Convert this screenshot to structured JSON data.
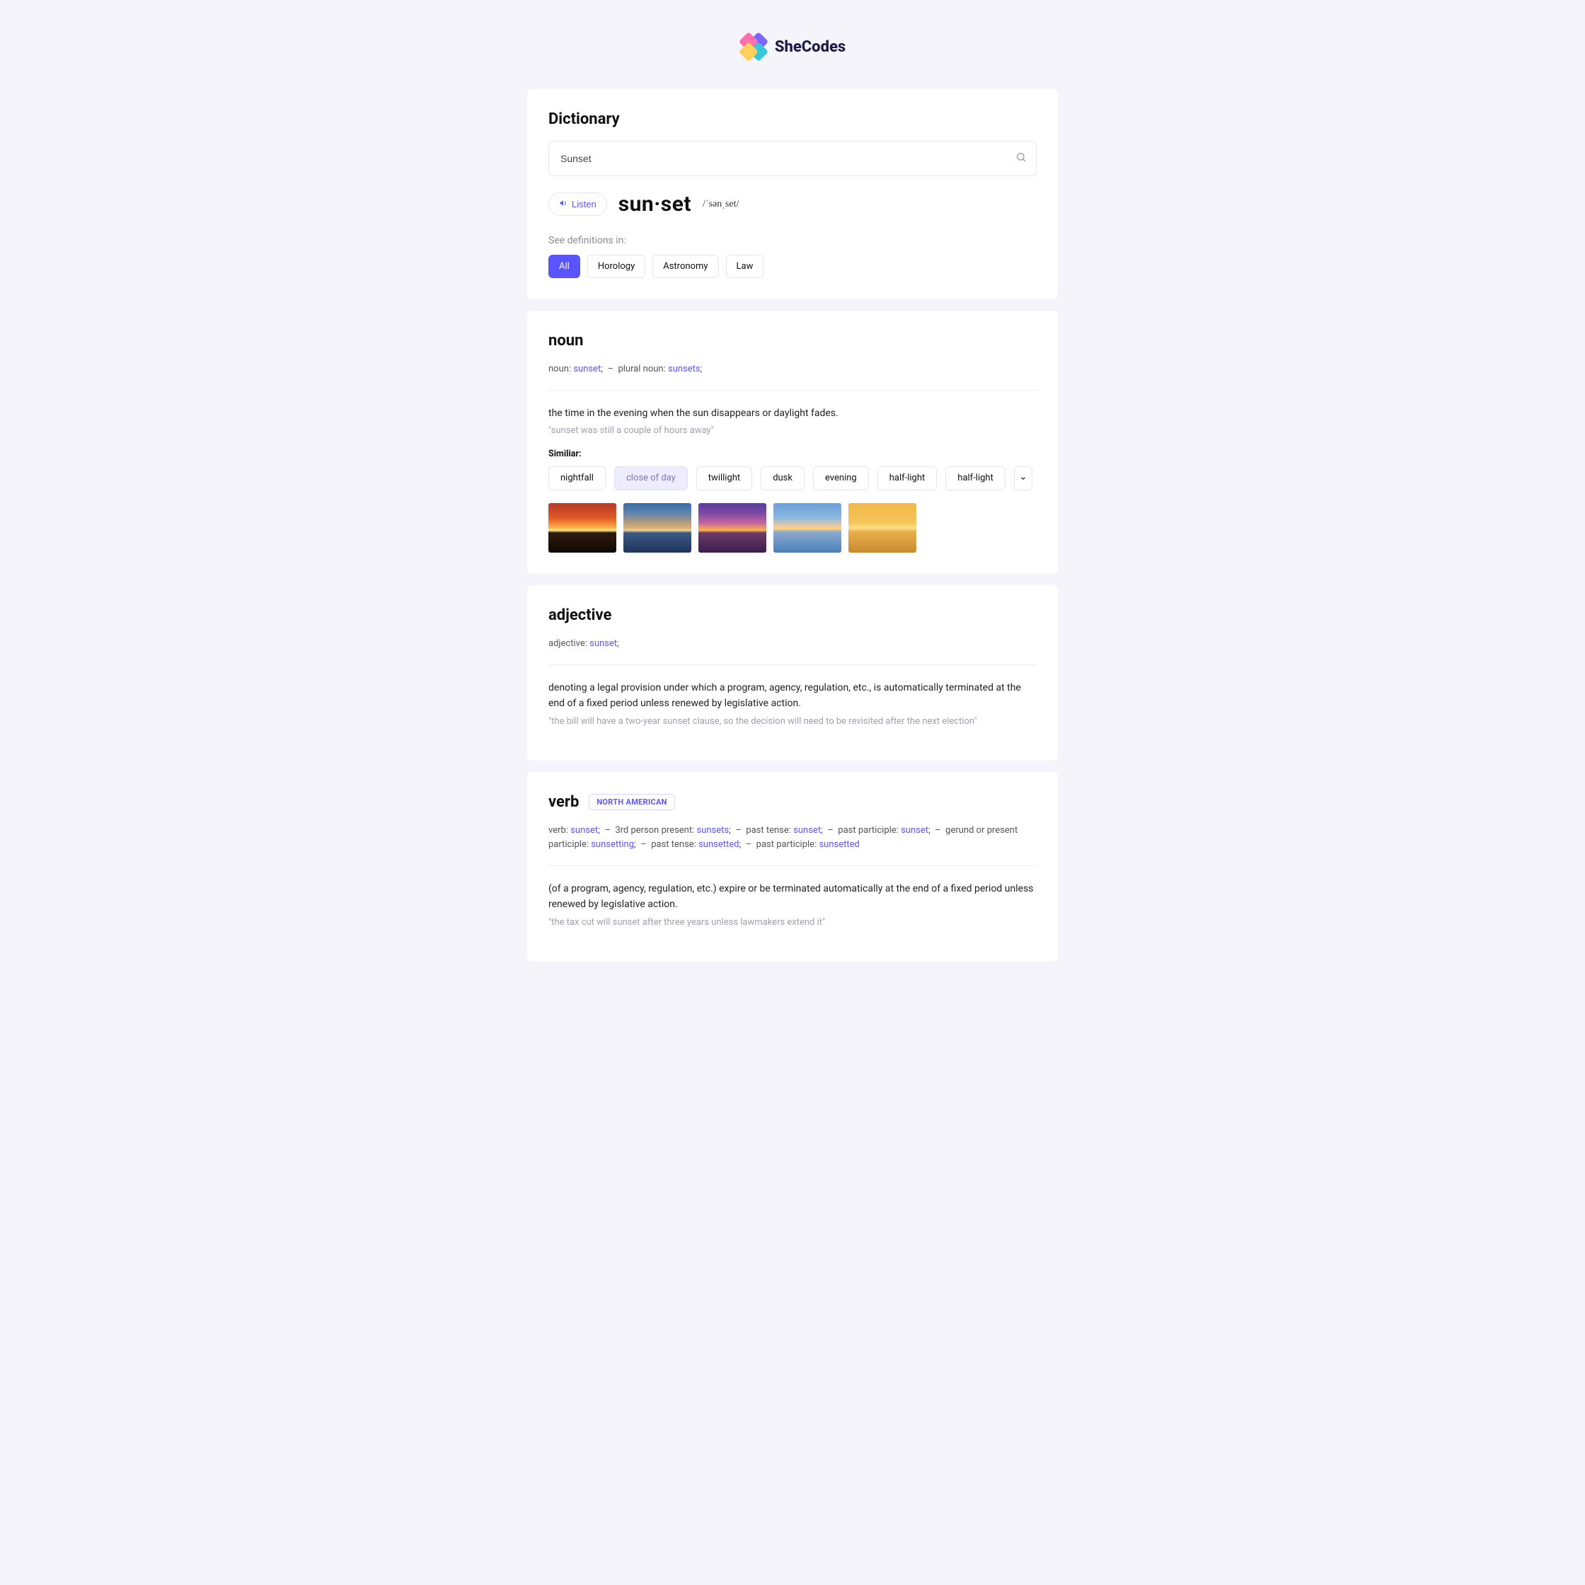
{
  "brand": {
    "name": "SheCodes"
  },
  "header": {
    "title": "Dictionary",
    "search_value": "Sunset",
    "listen_label": "Listen",
    "word": "sun·set",
    "phonetic": "/ˈsənˌset/",
    "see_definitions_label": "See definitions in:",
    "filters": {
      "all": "All",
      "horology": "Horology",
      "astronomy": "Astronomy",
      "law": "Law"
    }
  },
  "noun": {
    "heading": "noun",
    "forms": {
      "label_noun": "noun:",
      "val_noun": "sunset",
      "label_plural": "plural noun:",
      "val_plural": "sunsets"
    },
    "definition": "the time in the evening when the sun disappears or daylight fades.",
    "example": "\"sunset was still a couple of hours away\"",
    "similar_label": "Similiar:",
    "similar": {
      "nightfall": "nightfall",
      "close_of_day": "close of day",
      "twillight": "twillight",
      "dusk": "dusk",
      "evening": "evening",
      "half_light_1": "half-light",
      "half_light_2": "half-light"
    }
  },
  "adjective": {
    "heading": "adjective",
    "forms": {
      "label": "adjective:",
      "val": "sunset"
    },
    "definition": "denoting a legal provision under which a program, agency, regulation, etc., is automatically terminated at the end of a fixed period unless renewed by legislative action.",
    "example": "\"the bill will have a two-year sunset clause, so the decision will need to be revisited after the next election\""
  },
  "verb": {
    "heading": "verb",
    "tag": "NORTH AMERICAN",
    "forms": {
      "label_verb": "verb:",
      "val_verb": "sunset",
      "label_3rd": "3rd person present:",
      "val_3rd": "sunsets",
      "label_past": "past tense:",
      "val_past": "sunset",
      "label_pp": "past participle:",
      "val_pp": "sunset",
      "label_ger": "gerund or present participle:",
      "val_ger": "sunsetting",
      "label_past2": "past tense:",
      "val_past2": "sunsetted",
      "label_pp2": "past participle:",
      "val_pp2": "sunsetted"
    },
    "definition": "(of a program, agency, regulation, etc.) expire or be terminated automatically at the end of a fixed period unless renewed by legislative action.",
    "example": "\"the tax cut will sunset after three years unless lawmakers extend it\""
  }
}
